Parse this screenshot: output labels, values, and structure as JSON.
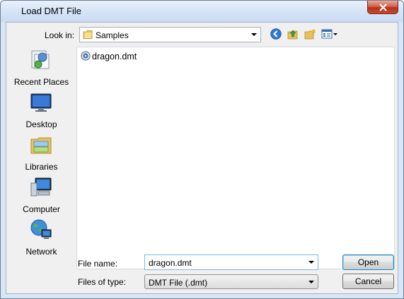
{
  "window": {
    "title": "Load DMT File"
  },
  "toolbar": {
    "look_in_label": "Look in:",
    "look_in_value": "Samples",
    "icons": [
      "back-icon",
      "up-folder-icon",
      "new-folder-icon",
      "view-menu-icon"
    ]
  },
  "places": [
    {
      "label": "Recent Places",
      "icon": "recent-places-icon"
    },
    {
      "label": "Desktop",
      "icon": "desktop-icon"
    },
    {
      "label": "Libraries",
      "icon": "libraries-icon"
    },
    {
      "label": "Computer",
      "icon": "computer-icon"
    },
    {
      "label": "Network",
      "icon": "network-icon"
    }
  ],
  "files": [
    {
      "name": "dragon.dmt",
      "icon": "dmt-file-icon"
    }
  ],
  "form": {
    "file_name_label": "File name:",
    "file_name_value": "dragon.dmt",
    "file_type_label": "Files of type:",
    "file_type_value": "DMT File (.dmt)"
  },
  "buttons": {
    "open": "Open",
    "cancel": "Cancel"
  },
  "colors": {
    "title_gradient_top": "#e9f1fb",
    "close_red": "#c8482d",
    "frame": "#d9e6f5"
  }
}
